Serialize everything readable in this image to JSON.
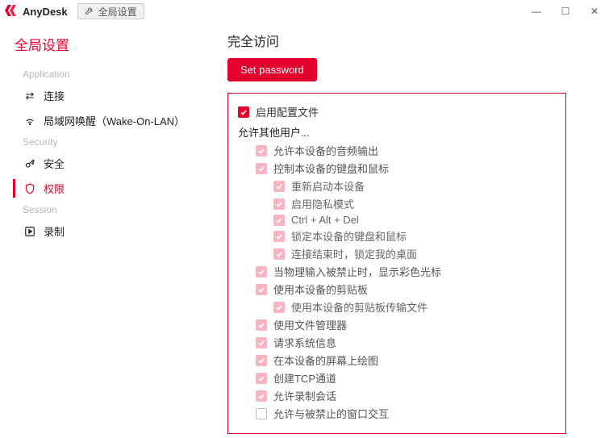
{
  "app": {
    "name": "AnyDesk",
    "tabLabel": "全局设置"
  },
  "windowControls": {
    "min": "—",
    "max": "☐",
    "close": "✕"
  },
  "sidebar": {
    "title": "全局设置",
    "groups": {
      "application": {
        "label": "Application"
      },
      "security": {
        "label": "Security"
      },
      "session": {
        "label": "Session"
      }
    },
    "items": {
      "connect": {
        "label": "连接"
      },
      "wol": {
        "label": "局域网唤醒（Wake-On-LAN）"
      },
      "security": {
        "label": "安全"
      },
      "permissions": {
        "label": "权限"
      },
      "recording": {
        "label": "录制"
      }
    }
  },
  "content": {
    "sectionTitle": "完全访问",
    "buttons": {
      "setPassword": "Set password"
    },
    "perm": {
      "enableProfile": "启用配置文件",
      "allowOthers": "允许其他用户...",
      "audio": "允许本设备的音频输出",
      "control": "控制本设备的键盘和鼠标",
      "restart": "重新启动本设备",
      "privacy": "启用隐私模式",
      "cad": "Ctrl + Alt + Del",
      "lockKbd": "锁定本设备的键盘和鼠标",
      "lockDesk": "连接结束时，锁定我的桌面",
      "cursor": "当物理输入被禁止时，显示彩色光标",
      "clipboard": "使用本设备的剪贴板",
      "clipFiles": "使用本设备的剪贴板传输文件",
      "fileMgr": "使用文件管理器",
      "sysinfo": "请求系统信息",
      "draw": "在本设备的屏幕上绘图",
      "tcp": "创建TCP通道",
      "record": "允许录制会话",
      "blocked": "允许与被禁止的窗口交互"
    }
  },
  "colors": {
    "accent": "#e4002b"
  }
}
